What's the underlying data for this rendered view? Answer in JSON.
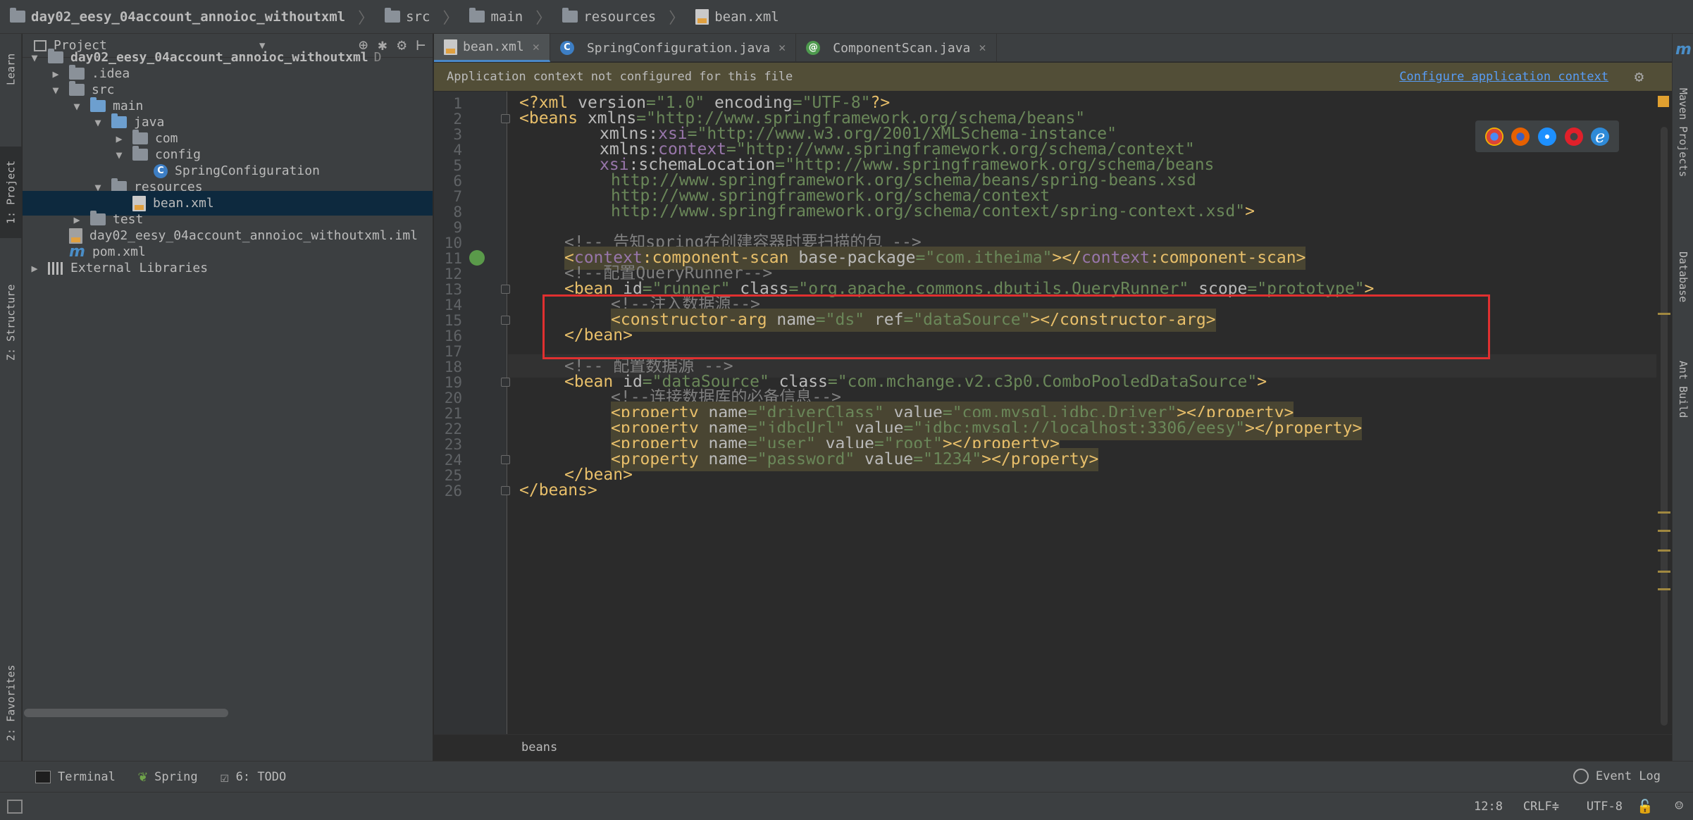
{
  "breadcrumbs": [
    "day02_eesy_04account_annoioc_withoutxml",
    "src",
    "main",
    "resources",
    "bean.xml"
  ],
  "left_strip": {
    "learn": "Learn",
    "project": "1: Project",
    "structure": "Z: Structure",
    "favorites": "2: Favorites"
  },
  "right_strip": {
    "maven": "Maven Projects",
    "database": "Database",
    "ant": "Ant Build"
  },
  "project_panel": {
    "title": "Project",
    "tree": [
      {
        "label": "day02_eesy_04account_annoioc_withoutxml",
        "suffix": "D",
        "depth": 0,
        "arrow": "▼",
        "icon": "folder-icon"
      },
      {
        "label": ".idea",
        "depth": 1,
        "arrow": "▶",
        "icon": "folder-icon"
      },
      {
        "label": "src",
        "depth": 1,
        "arrow": "▼",
        "icon": "folder-icon"
      },
      {
        "label": "main",
        "depth": 2,
        "arrow": "▼",
        "icon": "folder-icon"
      },
      {
        "label": "java",
        "depth": 3,
        "arrow": "▼",
        "icon": "folder-icon"
      },
      {
        "label": "com",
        "depth": 4,
        "arrow": "▶",
        "icon": "package-icon"
      },
      {
        "label": "config",
        "depth": 4,
        "arrow": "▼",
        "icon": "package-icon"
      },
      {
        "label": "SpringConfiguration",
        "depth": 5,
        "arrow": "",
        "icon": "class-icon"
      },
      {
        "label": "resources",
        "depth": 3,
        "arrow": "▼",
        "icon": "folder-icon"
      },
      {
        "label": "bean.xml",
        "depth": 4,
        "arrow": "",
        "icon": "xml-file-icon",
        "selected": true
      },
      {
        "label": "test",
        "depth": 2,
        "arrow": "▶",
        "icon": "folder-icon"
      },
      {
        "label": "day02_eesy_04account_annoioc_withoutxml.iml",
        "depth": 1,
        "arrow": "",
        "icon": "iml-file-icon"
      },
      {
        "label": "pom.xml",
        "depth": 1,
        "arrow": "",
        "icon": "maven-icon"
      },
      {
        "label": "External Libraries",
        "depth": 0,
        "arrow": "▶",
        "icon": "library-icon"
      }
    ]
  },
  "tabs": [
    {
      "label": "bean.xml",
      "active": true,
      "icon": "xml-file-icon"
    },
    {
      "label": "SpringConfiguration.java",
      "active": false,
      "icon": "class-icon"
    },
    {
      "label": "ComponentScan.java",
      "active": false,
      "icon": "annotation-icon"
    }
  ],
  "banner": {
    "message": "Application context not configured for this file",
    "action": "Configure application context"
  },
  "editor": {
    "line_numbers": [
      "1",
      "2",
      "3",
      "4",
      "5",
      "6",
      "7",
      "8",
      "9",
      "10",
      "11",
      "12",
      "13",
      "14",
      "15",
      "16",
      "17",
      "18",
      "19",
      "20",
      "21",
      "22",
      "23",
      "24",
      "25",
      "26"
    ],
    "breadcrumb": "beans"
  },
  "status": {
    "position": "12:8",
    "line_sep": "CRLF≑",
    "encoding": "UTF-8"
  },
  "toolwindows": {
    "terminal": "Terminal",
    "spring": "Spring",
    "todo": "6: TODO",
    "event_log": "Event Log"
  },
  "colors": {
    "tag": "#e8bf6a",
    "attr": "#bababa",
    "value": "#6a8759",
    "comment": "#808080",
    "namespace": "#9876aa",
    "highlight_box": "#e03030"
  }
}
